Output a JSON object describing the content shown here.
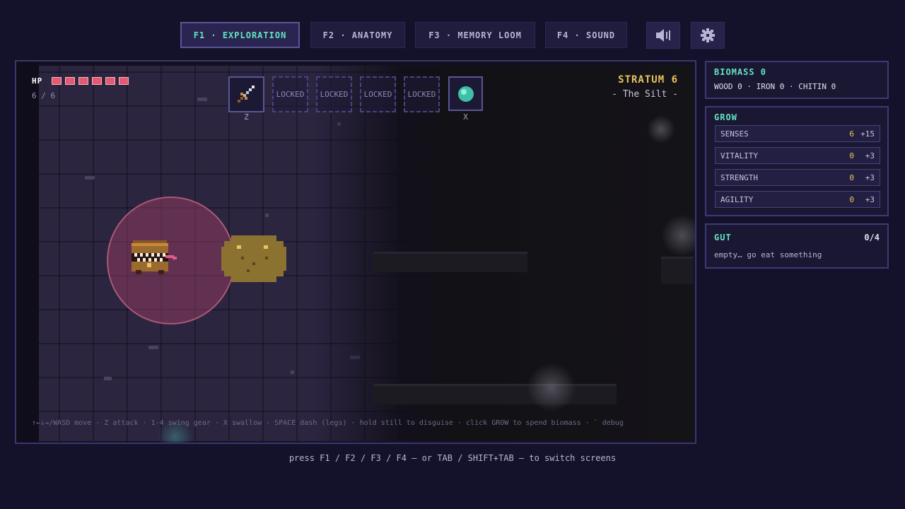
{
  "tabs": [
    {
      "label": "F1 · EXPLORATION",
      "active": true
    },
    {
      "label": "F2 · ANATOMY",
      "active": false
    },
    {
      "label": "F3 · MEMORY LOOM",
      "active": false
    },
    {
      "label": "F4 · SOUND",
      "active": false
    }
  ],
  "toolbar": {
    "mute_icon": "speaker-mute-icon",
    "settings_icon": "gear-icon"
  },
  "hud": {
    "hp_label": "HP",
    "hp_current": 6,
    "hp_max": 6,
    "hp_text": "6 / 6",
    "slots": [
      {
        "label": "",
        "icon": "sword-icon",
        "key": "Z"
      },
      {
        "label": "LOCKED"
      },
      {
        "label": "LOCKED"
      },
      {
        "label": "LOCKED"
      },
      {
        "label": "LOCKED"
      },
      {
        "label": "",
        "icon": "orb-icon",
        "key": "X"
      }
    ],
    "stratum_title": "STRATUM 6",
    "stratum_name": "- The Silt -",
    "controls": "↑←↓→/WASD move · Z attack · 1-4 swing gear · X swallow · SPACE dash (legs) · hold still to disguise · click GROW to spend biomass · ` debug"
  },
  "resources": {
    "biomass_label": "BIOMASS 0",
    "materials": "WOOD 0 · IRON 0 · CHITIN 0"
  },
  "grow": {
    "title": "GROW",
    "stats": [
      {
        "name": "SENSES",
        "value": "6",
        "cost": "+15"
      },
      {
        "name": "VITALITY",
        "value": "0",
        "cost": "+3"
      },
      {
        "name": "STRENGTH",
        "value": "0",
        "cost": "+3"
      },
      {
        "name": "AGILITY",
        "value": "0",
        "cost": "+3"
      }
    ]
  },
  "gut": {
    "title": "GUT",
    "count": "0/4",
    "message": "empty… go eat something"
  },
  "footer": {
    "hint": "press F1 / F2 / F3 / F4 — or TAB / SHIFT+TAB — to switch screens"
  },
  "colors": {
    "accent": "#63e3c2",
    "gold": "#e9c35c",
    "hp": "#e35b73",
    "aura": "#be466e"
  }
}
